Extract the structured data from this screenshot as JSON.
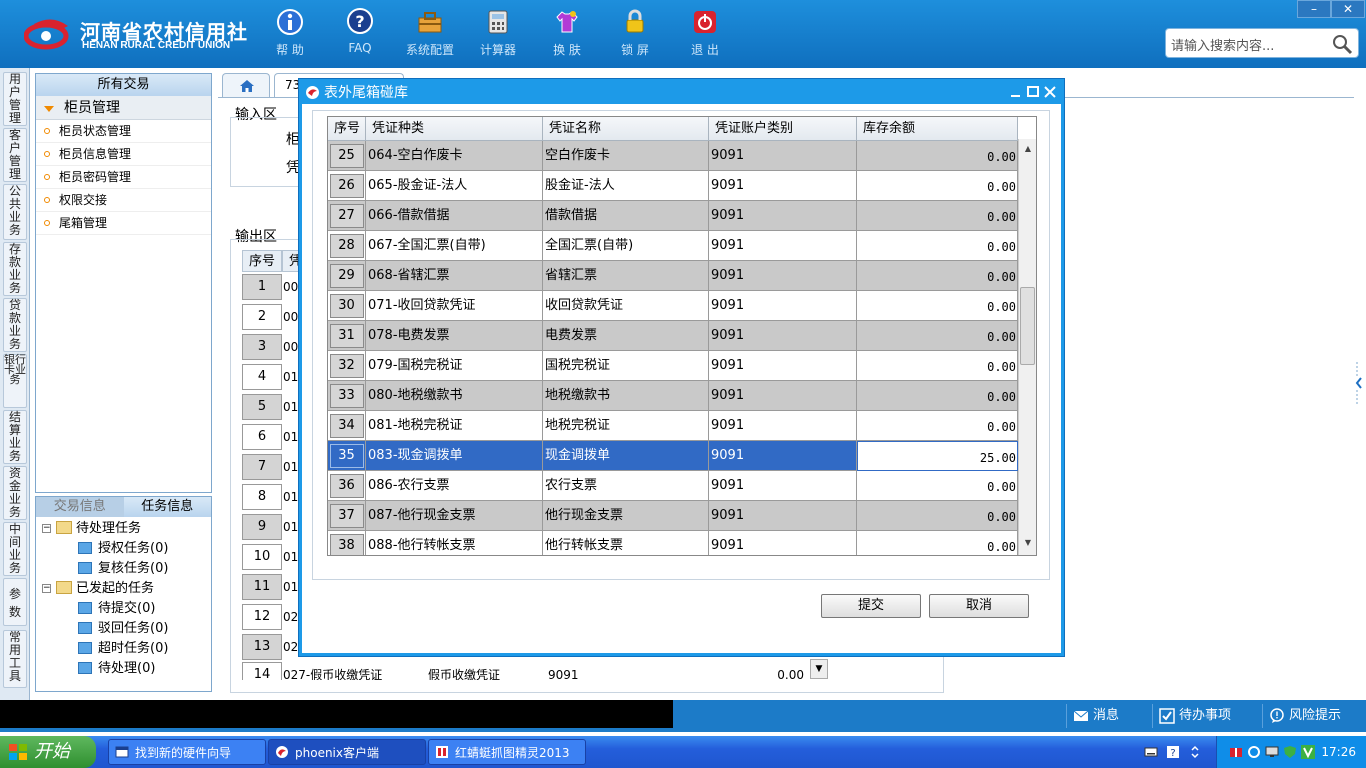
{
  "header": {
    "logo_cn": "河南省农村信用社",
    "logo_en": "HENAN RURAL CREDIT UNION",
    "toolbar": [
      {
        "label": "帮 助",
        "icon": "info-icon"
      },
      {
        "label": "FAQ",
        "icon": "help-icon"
      },
      {
        "label": "系统配置",
        "icon": "toolbox-icon"
      },
      {
        "label": "计算器",
        "icon": "calculator-icon"
      },
      {
        "label": "换 肤",
        "icon": "shirt-icon"
      },
      {
        "label": "锁 屏",
        "icon": "lock-icon"
      },
      {
        "label": "退 出",
        "icon": "power-icon"
      }
    ],
    "search_placeholder": "请输入搜索内容...",
    "window_min": "–",
    "window_close": "✕"
  },
  "rail": [
    {
      "label": "用户管理"
    },
    {
      "label": "客户管理"
    },
    {
      "label": "公共业务"
    },
    {
      "label": "存款业务"
    },
    {
      "label": "贷款业务"
    },
    {
      "label": "银行卡业务"
    },
    {
      "label": "结算业务"
    },
    {
      "label": "资金业务"
    },
    {
      "label": "中间业务"
    },
    {
      "label": "参数"
    },
    {
      "label": "常用工具"
    }
  ],
  "menu": {
    "header": "所有交易",
    "group": "柜员管理",
    "items": [
      "柜员状态管理",
      "柜员信息管理",
      "柜员密码管理",
      "权限交接",
      "尾箱管理"
    ]
  },
  "tasks": {
    "tabs": [
      "交易信息",
      "任务信息"
    ],
    "tree": [
      {
        "label": "待处理任务",
        "level": 0
      },
      {
        "label": "授权任务(0)",
        "level": 1
      },
      {
        "label": "复核任务(0)",
        "level": 1
      },
      {
        "label": "已发起的任务",
        "level": 0
      },
      {
        "label": "待提交(0)",
        "level": 1
      },
      {
        "label": "驳回任务(0)",
        "level": 1
      },
      {
        "label": "超时任务(0)",
        "level": 1
      },
      {
        "label": "待处理(0)",
        "level": 1
      }
    ]
  },
  "content": {
    "tab2_label": "73",
    "input_label": "输入区",
    "input_chars": [
      "柜",
      "凭"
    ],
    "output_label": "输出区",
    "bg_header": "序号",
    "bg_header2": "凭",
    "bg_rows": [
      {
        "n": "1",
        "c": "00"
      },
      {
        "n": "2",
        "c": "00"
      },
      {
        "n": "3",
        "c": "00"
      },
      {
        "n": "4",
        "c": "01"
      },
      {
        "n": "5",
        "c": "01"
      },
      {
        "n": "6",
        "c": "01"
      },
      {
        "n": "7",
        "c": "01"
      },
      {
        "n": "8",
        "c": "01"
      },
      {
        "n": "9",
        "c": "01"
      },
      {
        "n": "10",
        "c": "01"
      },
      {
        "n": "11",
        "c": "01"
      },
      {
        "n": "12",
        "c": "02"
      },
      {
        "n": "13",
        "c": "02"
      }
    ],
    "bg_last_row": {
      "n": "14",
      "type": "027-假币收缴凭证",
      "name": "假币收缴凭证",
      "acct": "9091",
      "bal": "0.00"
    }
  },
  "dialog": {
    "title": "表外尾箱碰库",
    "columns": [
      "序号",
      "凭证种类",
      "凭证名称",
      "凭证账户类别",
      "库存余额"
    ],
    "rows": [
      {
        "no": "25",
        "type": "064-空白作废卡",
        "name": "空白作废卡",
        "acct": "9091",
        "bal": "0.00"
      },
      {
        "no": "26",
        "type": "065-股金证-法人",
        "name": "股金证-法人",
        "acct": "9091",
        "bal": "0.00"
      },
      {
        "no": "27",
        "type": "066-借款借据",
        "name": "借款借据",
        "acct": "9091",
        "bal": "0.00"
      },
      {
        "no": "28",
        "type": "067-全国汇票(自带)",
        "name": "全国汇票(自带)",
        "acct": "9091",
        "bal": "0.00"
      },
      {
        "no": "29",
        "type": "068-省辖汇票",
        "name": "省辖汇票",
        "acct": "9091",
        "bal": "0.00"
      },
      {
        "no": "30",
        "type": "071-收回贷款凭证",
        "name": "收回贷款凭证",
        "acct": "9091",
        "bal": "0.00"
      },
      {
        "no": "31",
        "type": "078-电费发票",
        "name": "电费发票",
        "acct": "9091",
        "bal": "0.00"
      },
      {
        "no": "32",
        "type": "079-国税完税证",
        "name": "国税完税证",
        "acct": "9091",
        "bal": "0.00"
      },
      {
        "no": "33",
        "type": "080-地税缴款书",
        "name": "地税缴款书",
        "acct": "9091",
        "bal": "0.00"
      },
      {
        "no": "34",
        "type": "081-地税完税证",
        "name": "地税完税证",
        "acct": "9091",
        "bal": "0.00"
      },
      {
        "no": "35",
        "type": "083-现金调拨单",
        "name": "现金调拨单",
        "acct": "9091",
        "bal": "25.00"
      },
      {
        "no": "36",
        "type": "086-农行支票",
        "name": "农行支票",
        "acct": "9091",
        "bal": "0.00"
      },
      {
        "no": "37",
        "type": "087-他行现金支票",
        "name": "他行现金支票",
        "acct": "9091",
        "bal": "0.00"
      },
      {
        "no": "38",
        "type": "088-他行转帐支票",
        "name": "他行转帐支票",
        "acct": "9091",
        "bal": "0.00"
      }
    ],
    "selected_row": "35",
    "submit": "提交",
    "cancel": "取消"
  },
  "statusbar": {
    "messages": "消息",
    "todo": "待办事项",
    "risk": "风险提示"
  },
  "taskbar": {
    "start": "开始",
    "items": [
      "找到新的硬件向导",
      "phoenix客户端",
      "红蜻蜓抓图精灵2013"
    ],
    "time": "17:26"
  },
  "colors": {
    "header_blue": "#1e8fdc",
    "dialog_border": "#1d9ae8",
    "selected_row": "#316ac5"
  }
}
